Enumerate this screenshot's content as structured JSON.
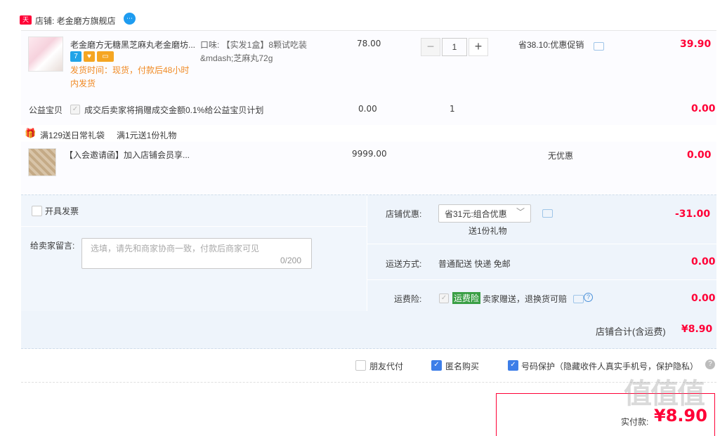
{
  "shop": {
    "badge": "天猫",
    "name": "店铺: 老金磨方旗舰店",
    "ww_icon": "⋯"
  },
  "item1": {
    "title": "老金磨方无糖黑芝麻丸老金磨坊...",
    "tags": [
      "7",
      "♥",
      "▭"
    ],
    "ship_time": "发货时间：现货，付款后48小时内发货",
    "sku": "口味: 【实发1盒】8颗试吃装&mdash;芝麻丸72g",
    "unit_price": "78.00",
    "quantity": "1",
    "minus": "−",
    "plus": "+",
    "promo": "省38.10:优惠促销",
    "total": "39.90"
  },
  "welfare": {
    "label": "公益宝贝",
    "check": "✓",
    "text": "成交后卖家将捐赠成交金额0.1%给公益宝贝计划",
    "price": "0.00",
    "qty": "1",
    "total": "0.00"
  },
  "gift": {
    "icon": "🎁",
    "label1": "满129送日常礼袋",
    "label2": "满1元送1份礼物"
  },
  "item2": {
    "title": "【入会邀请函】加入店铺会员享...",
    "price": "9999.00",
    "promo": "无优惠",
    "total": "0.00"
  },
  "options": {
    "invoice": "开具发票",
    "message_label": "给卖家留言:",
    "message_placeholder": "选填，请先和商家协商一致，付款后商家可见",
    "message_count": "0/200",
    "shop_discount_label": "店铺优惠:",
    "shop_discount_value": "省31元:组合优惠",
    "dropdown_arrow": "﹀",
    "gift_note": "送1份礼物",
    "shop_discount_amount": "-31.00",
    "shipping_label": "运送方式:",
    "shipping_value": "普通配送 快递 免邮",
    "shipping_amount": "0.00",
    "insurance_label": "运费险:",
    "insurance_check": "✓",
    "insurance_tag": "运费险",
    "insurance_text": "卖家赠送，退换货可赔",
    "insurance_help": "?",
    "insurance_amount": "0.00"
  },
  "total": {
    "label": "店铺合计(含运费)",
    "value": "¥8.90"
  },
  "extras": {
    "friend_pay": "朋友代付",
    "anonymous": "匿名购买",
    "privacy": "号码保护（隐藏收件人真实手机号，保护隐私）",
    "check": "✓",
    "help": "?"
  },
  "payment": {
    "label": "实付款:",
    "value": "¥8.90"
  },
  "watermark": "值值值"
}
